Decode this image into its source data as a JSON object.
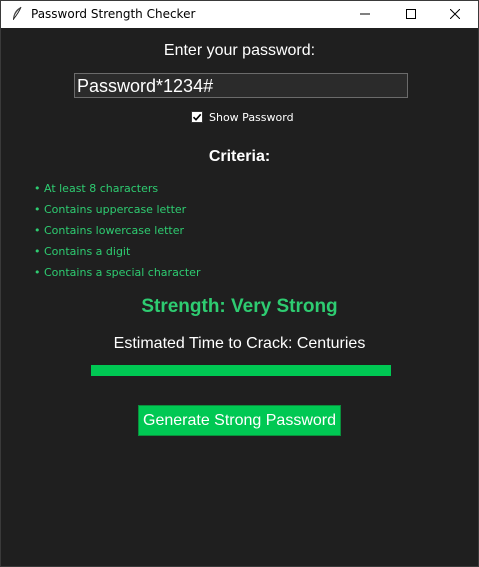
{
  "window": {
    "title": "Password Strength Checker",
    "icons": {
      "app": "feather-icon",
      "minimize": "minimize-icon",
      "maximize": "maximize-icon",
      "close": "close-icon"
    }
  },
  "form": {
    "prompt_label": "Enter your password:",
    "password_value": "Password*1234#",
    "show_password_label": "Show Password",
    "show_password_checked": true
  },
  "criteria": {
    "title": "Criteria:",
    "items": [
      "• At least 8 characters",
      "• Contains uppercase letter",
      "• Contains lowercase letter",
      "• Contains a digit",
      "• Contains a special character"
    ]
  },
  "result": {
    "strength_text": "Strength: Very Strong",
    "crack_time_text": "Estimated Time to Crack: Centuries",
    "progress_fraction": 1.0
  },
  "actions": {
    "generate_label": "Generate Strong Password"
  },
  "colors": {
    "background": "#1f1f1f",
    "accent_green": "#2ecc71",
    "button_green": "#00c853",
    "text": "#ffffff"
  }
}
